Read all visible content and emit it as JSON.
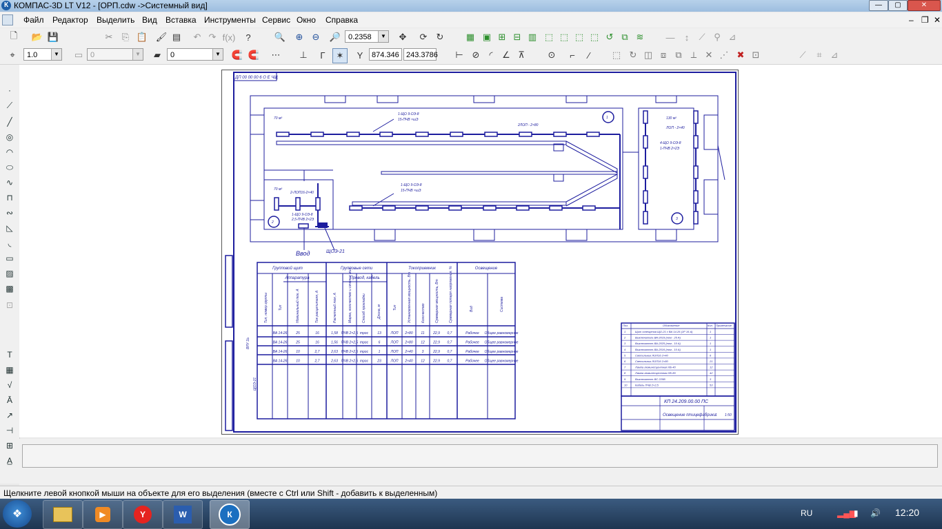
{
  "window": {
    "title": "КОМПАС-3D LT V12 - [ОРП.cdw ->Системный вид]",
    "app_icon": "К"
  },
  "menu": [
    "Файл",
    "Редактор",
    "Выделить",
    "Вид",
    "Вставка",
    "Инструменты",
    "Сервис",
    "Окно",
    "Справка"
  ],
  "toolbar1": {
    "zoom_value": "0.2358"
  },
  "toolbar2": {
    "style_value": "1.0",
    "layer_value": "0",
    "state_value": "0",
    "coord_x": "874.346",
    "coord_y": "243.3786"
  },
  "drawing": {
    "stamp_code": "ДП 00 00 00 6 О Е ЧЩ",
    "room_label_1": "70 м²",
    "room_label_2": "70 м²",
    "room_label_3": "130 м²",
    "zone_note_1": "1-ЩО 9-ОЭ-8",
    "zone_note_2": "15-ПЧВ ×шЭ",
    "zone_note_3": "2ЛОП - 2×80",
    "zone_note_4": "1-ЩО 9-ОЭ-8",
    "zone_note_5": "15-ПЧВ ×шЭ",
    "zone_note_6": "ЛОП - 2×40",
    "zone_note_7": "4-ЩО 9-ОЭ-8",
    "zone_note_8": "1-ПЧВ 2×2Э",
    "zone_note_9": "2-ЛОП16-2×40",
    "zone_note_10": "1-ЩО 9-ОЭ-8",
    "zone_note_11": "2,5-ПЧВ 2×2Э",
    "marker_1": "1",
    "marker_2": "2",
    "marker_3": "3",
    "entry_label": "Ввод",
    "panel_label": "ЩОЭ-21",
    "table": {
      "group_shield": "Групповой щит",
      "group_nets": "Групповые сети",
      "receivers": "Токоприемник",
      "lighting": "Освещение",
      "apparatus": "Аппаратура",
      "wire": "Провод, кабель",
      "col_group_no": "Тип, номер группы",
      "col_type": "Тип",
      "col_nominal": "Номинальный ток, А",
      "col_setting": "Ток расцепителя, А",
      "col_calc_current": "Расчетный ток, А",
      "col_mark": "Марка, количество и сечение жил",
      "col_method": "Способ прокладки",
      "col_length": "Длина, м",
      "col_rec_type": "Тип",
      "col_power": "Установленная мощность, Вт",
      "col_qty": "Количество",
      "col_total_power": "Суммарная мощность, Вт",
      "col_losses": "Суммарная потеря напряжения, %",
      "col_kind": "Вид",
      "col_system": "Система",
      "rows": [
        {
          "type": "ВА 14-26",
          "nominal": "25",
          "setting": "16",
          "calc": "1,58",
          "mark": "ПЧВ 2×2,5",
          "method": "трос",
          "length": "13",
          "rtype": "ЛОП",
          "power": "2×80",
          "qty": "11",
          "total": "22,9",
          "loss": "0,7",
          "kind": "Рабочее",
          "system": "Общее равномерное"
        },
        {
          "type": "ВА 14-26",
          "nominal": "25",
          "setting": "16",
          "calc": "1,56",
          "mark": "ПЧВ 2×2,5",
          "method": "трос",
          "length": "6",
          "rtype": "ЛОП",
          "power": "2×80",
          "qty": "12",
          "total": "22,9",
          "loss": "0,7",
          "kind": "Рабочее",
          "system": "Общее равномерное"
        },
        {
          "type": "ВА 14-26",
          "nominal": "10",
          "setting": "2,7",
          "calc": "2,63",
          "mark": "ПЧВ 2×2,5",
          "method": "трос",
          "length": "1",
          "rtype": "ЛОП",
          "power": "2×40",
          "qty": "3",
          "total": "22,9",
          "loss": "0,7",
          "kind": "Рабочее",
          "system": "Общее равномерное"
        },
        {
          "type": "ВА 14-26",
          "nominal": "10",
          "setting": "2,7",
          "calc": "2,63",
          "mark": "ПЧВ 2×2,5",
          "method": "трос",
          "length": "23",
          "rtype": "ЛОП",
          "power": "2×40",
          "qty": "12",
          "total": "22,9",
          "loss": "0,7",
          "kind": "Рабочее",
          "system": "Общее равномерное"
        }
      ],
      "shield_left": "ЩОЭ-21",
      "shield_right": "ВРУ 1Ь"
    },
    "spec": {
      "h_pos": "Поз.",
      "h_name": "Обозначение",
      "h_qty": "Кол.",
      "h_note": "Примечание",
      "rows": [
        {
          "pos": "1",
          "name": "Щит освещения ЩО-21 с ВА 14-26 (1Р 16 А)",
          "qty": "1"
        },
        {
          "pos": "2",
          "name": "Выключатель ВА-2019 (ном - 25 А)",
          "qty": "1"
        },
        {
          "pos": "3",
          "name": "Выключатель ВА-2025 (ном - 10 А)",
          "qty": "1"
        },
        {
          "pos": "4",
          "name": "Выключатель ВА-2016 (ном - 10 А)",
          "qty": "1"
        },
        {
          "pos": "5",
          "name": "Светильник ЛОП16 2×40",
          "qty": "6"
        },
        {
          "pos": "6",
          "name": "Светильник ЛОП16 2×80",
          "qty": "21"
        },
        {
          "pos": "7",
          "name": "Лампа люминесцентная ЛБ-40",
          "qty": "12"
        },
        {
          "pos": "8",
          "name": "Лампа люминесцентная ЛБ-80",
          "qty": "42"
        },
        {
          "pos": "9",
          "name": "Выключатель ВС 220В",
          "qty": "3"
        },
        {
          "pos": "10",
          "name": "Кабель ПЧВ 2×2,5",
          "qty": "53"
        }
      ]
    },
    "title_block": {
      "code": "КП 24.209.00.00 ПС",
      "name": "Освещение птицефабрики",
      "sheet": "1",
      "scale": "1:50"
    }
  },
  "status": "Щелкните левой кнопкой мыши на объекте для его выделения (вместе с Ctrl или Shift - добавить к выделенным)",
  "taskbar": {
    "language": "RU",
    "clock": "12:20",
    "word_label": "W"
  },
  "colors": {
    "drawing": "#1c1c9e",
    "titlebar": "#b7d1ea",
    "taskbar": "#1e3550"
  }
}
